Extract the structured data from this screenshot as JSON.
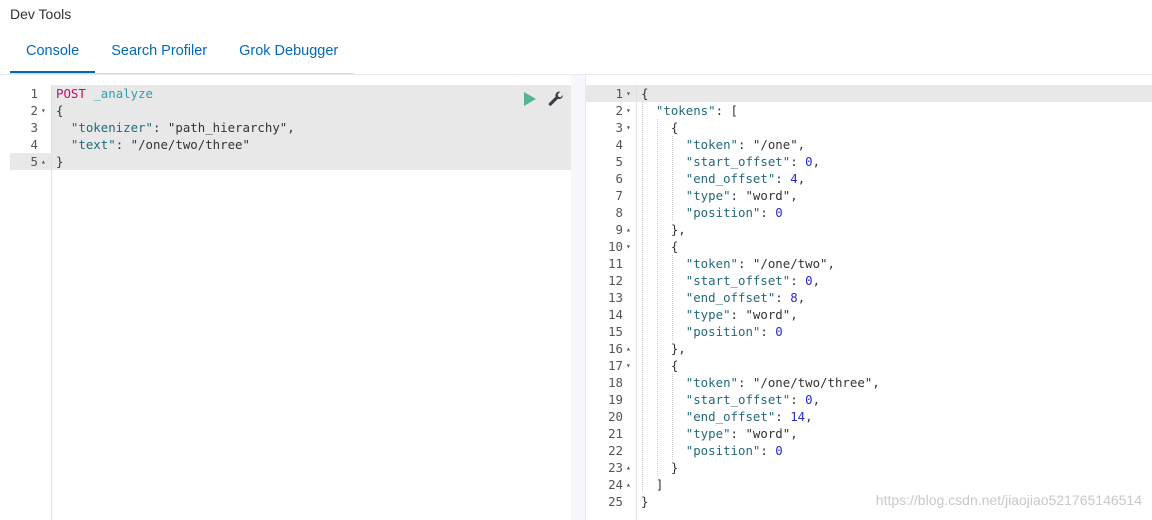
{
  "app": {
    "title": "Dev Tools"
  },
  "tabs": [
    {
      "label": "Console",
      "active": true
    },
    {
      "label": "Search Profiler",
      "active": false
    },
    {
      "label": "Grok Debugger",
      "active": false
    }
  ],
  "request": {
    "line_numbers": [
      "1",
      "2",
      "3",
      "4",
      "5"
    ],
    "method": "POST",
    "url": "_analyze",
    "open_brace": "{",
    "close_brace": "}",
    "body": [
      {
        "key": "\"tokenizer\"",
        "value": "\"path_hierarchy\"",
        "trail": ","
      },
      {
        "key": "\"text\"",
        "value": "\"/one/two/three\"",
        "trail": ""
      }
    ],
    "run_icon": "play-icon",
    "settings_icon": "wrench-icon",
    "accent_color": "#54b399"
  },
  "response": {
    "line_numbers": [
      "1",
      "2",
      "3",
      "4",
      "5",
      "6",
      "7",
      "8",
      "9",
      "10",
      "11",
      "12",
      "13",
      "14",
      "15",
      "16",
      "17",
      "18",
      "19",
      "20",
      "21",
      "22",
      "23",
      "24",
      "25"
    ],
    "lines": [
      "{",
      "  \"tokens\": [",
      "    {",
      "      \"token\": \"/one\",",
      "      \"start_offset\": 0,",
      "      \"end_offset\": 4,",
      "      \"type\": \"word\",",
      "      \"position\": 0",
      "    },",
      "    {",
      "      \"token\": \"/one/two\",",
      "      \"start_offset\": 0,",
      "      \"end_offset\": 8,",
      "      \"type\": \"word\",",
      "      \"position\": 0",
      "    },",
      "    {",
      "      \"token\": \"/one/two/three\",",
      "      \"start_offset\": 0,",
      "      \"end_offset\": 14,",
      "      \"type\": \"word\",",
      "      \"position\": 0",
      "    }",
      "  ]",
      "}"
    ],
    "fold_open_lines": [
      "1",
      "2",
      "3",
      "10",
      "17"
    ],
    "fold_close_lines": [
      "9",
      "16",
      "23",
      "24"
    ]
  },
  "watermark": "https://blog.csdn.net/jiaojiao521765146514"
}
